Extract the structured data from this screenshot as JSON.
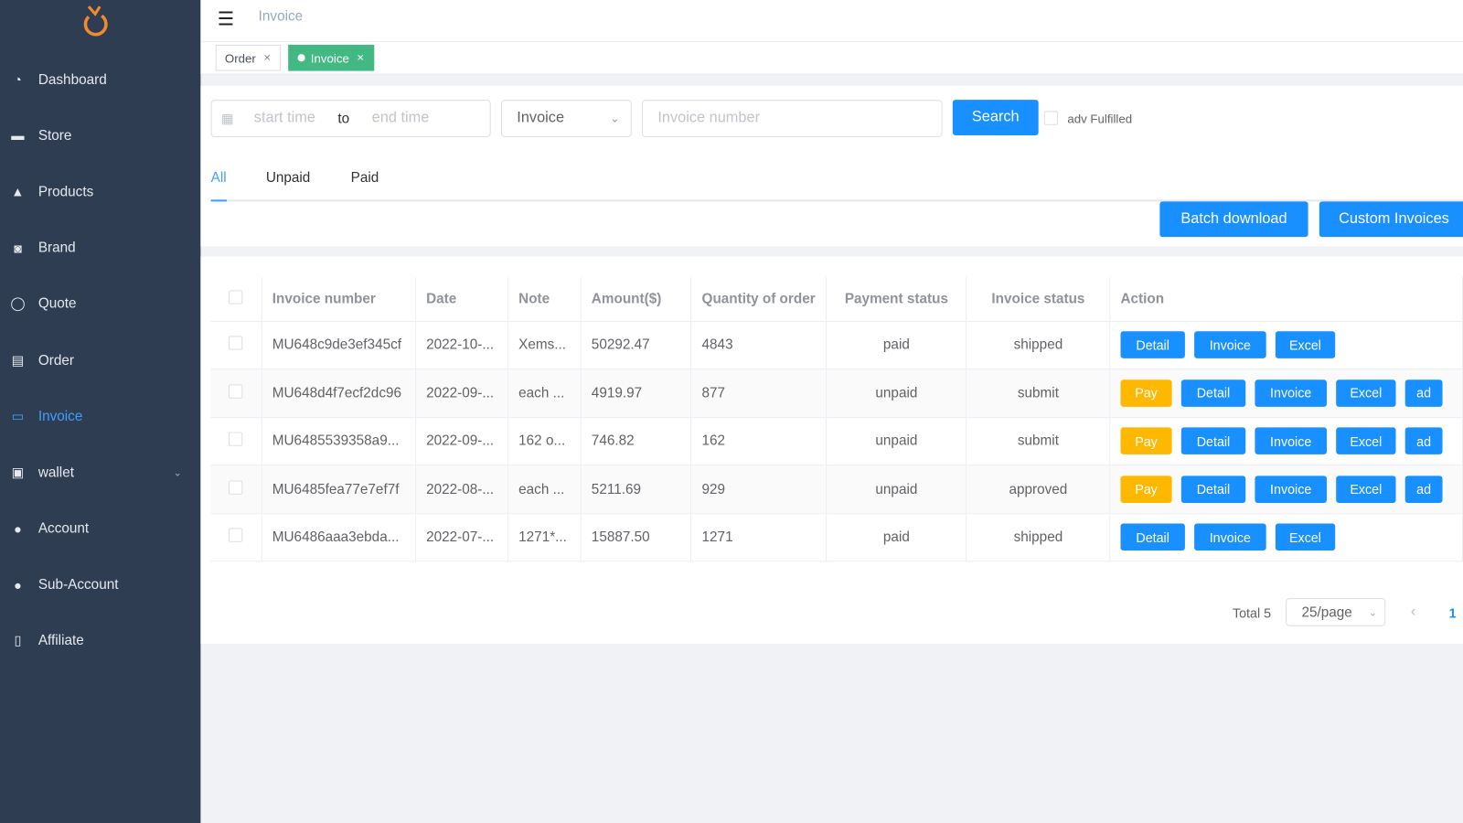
{
  "sidebar": {
    "items": [
      {
        "label": "Dashboard",
        "icon": "dashboard-icon"
      },
      {
        "label": "Store",
        "icon": "store-icon"
      },
      {
        "label": "Products",
        "icon": "products-icon"
      },
      {
        "label": "Brand",
        "icon": "brand-icon"
      },
      {
        "label": "Quote",
        "icon": "chat-icon"
      },
      {
        "label": "Order",
        "icon": "order-icon"
      },
      {
        "label": "Invoice",
        "icon": "invoice-icon",
        "active": true
      },
      {
        "label": "wallet",
        "icon": "wallet-icon"
      },
      {
        "label": "Account",
        "icon": "user-icon"
      },
      {
        "label": "Sub-Account",
        "icon": "user-icon"
      },
      {
        "label": "Affiliate",
        "icon": "affiliate-icon"
      }
    ]
  },
  "header": {
    "breadcrumb": "Invoice"
  },
  "tags": [
    {
      "label": "Order"
    },
    {
      "label": "Invoice",
      "active": true
    }
  ],
  "filters": {
    "start_placeholder": "start time",
    "to": "to",
    "end_placeholder": "end time",
    "type_select": "Invoice",
    "number_placeholder": "Invoice number",
    "search": "Search",
    "adv_label": "adv Fulfilled"
  },
  "tabs": [
    "All",
    "Unpaid",
    "Paid"
  ],
  "actions": {
    "batch": "Batch download",
    "custom": "Custom Invoices"
  },
  "table": {
    "headers": [
      "Invoice number",
      "Date",
      "Note",
      "Amount($)",
      "Quantity of order",
      "Payment status",
      "Invoice status",
      "Action"
    ],
    "rows": [
      {
        "number": "MU648c9de3ef345cf",
        "date": "2022-10-...",
        "note": "Xems...",
        "amount": "50292.47",
        "qty": "4843",
        "payment": "paid",
        "status": "shipped",
        "buttons": [
          "Detail",
          "Invoice",
          "Excel"
        ]
      },
      {
        "number": "MU648d4f7ecf2dc96",
        "date": "2022-09-...",
        "note": "each ...",
        "amount": "4919.97",
        "qty": "877",
        "payment": "unpaid",
        "status": "submit",
        "buttons": [
          "Pay",
          "Detail",
          "Invoice",
          "Excel",
          "ad"
        ]
      },
      {
        "number": "MU6485539358a9...",
        "date": "2022-09-...",
        "note": "162 o...",
        "amount": "746.82",
        "qty": "162",
        "payment": "unpaid",
        "status": "submit",
        "buttons": [
          "Pay",
          "Detail",
          "Invoice",
          "Excel",
          "ad"
        ]
      },
      {
        "number": "MU6485fea77e7ef7f",
        "date": "2022-08-...",
        "note": "each ...",
        "amount": "5211.69",
        "qty": "929",
        "payment": "unpaid",
        "status": "approved",
        "buttons": [
          "Pay",
          "Detail",
          "Invoice",
          "Excel",
          "ad"
        ]
      },
      {
        "number": "MU6486aaa3ebda...",
        "date": "2022-07-...",
        "note": "1271*...",
        "amount": "15887.50",
        "qty": "1271",
        "payment": "paid",
        "status": "shipped",
        "buttons": [
          "Detail",
          "Invoice",
          "Excel"
        ]
      }
    ]
  },
  "pagination": {
    "total": "Total 5",
    "page_size": "25/page",
    "current": "1"
  },
  "colors": {
    "sidebar": "#2f3d53",
    "primary": "#1890ff",
    "pay": "#ffb800",
    "tag_active": "#42b983",
    "logo": "#f08a2c"
  }
}
